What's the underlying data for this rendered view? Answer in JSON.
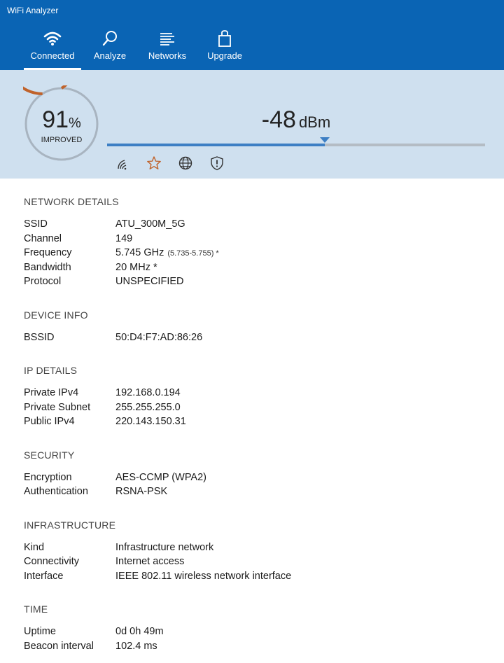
{
  "app": {
    "title": "WiFi Analyzer"
  },
  "nav": {
    "items": [
      {
        "label": "Connected",
        "icon": "wifi-icon"
      },
      {
        "label": "Analyze",
        "icon": "magnifier-icon"
      },
      {
        "label": "Networks",
        "icon": "list-icon"
      },
      {
        "label": "Upgrade",
        "icon": "shopping-bag-icon"
      }
    ],
    "active": "Connected"
  },
  "signal": {
    "quality_value": "91",
    "quality_unit": "%",
    "quality_label": "IMPROVED",
    "quality_fraction": 0.91,
    "dbm_value": "-48",
    "dbm_unit": "dBm",
    "meter_fraction": 0.575,
    "colors": {
      "gauge_ring": "#c0622a",
      "gauge_track": "#a8b4c0",
      "meter": "#3d7fc4",
      "star": "#c0622a"
    },
    "status_icons": [
      "signal-bars-icon",
      "star-icon",
      "globe-icon",
      "shield-icon"
    ]
  },
  "sections": {
    "network": {
      "title": "NETWORK DETAILS",
      "ssid_k": "SSID",
      "ssid_v": "ATU_300M_5G",
      "channel_k": "Channel",
      "channel_v": "149",
      "frequency_k": "Frequency",
      "frequency_v": "5.745 GHz",
      "frequency_range": "(5.735-5.755) *",
      "bandwidth_k": "Bandwidth",
      "bandwidth_v": "20 MHz *",
      "protocol_k": "Protocol",
      "protocol_v": "UNSPECIFIED"
    },
    "device": {
      "title": "DEVICE INFO",
      "bssid_k": "BSSID",
      "bssid_v": "50:D4:F7:AD:86:26"
    },
    "ip": {
      "title": "IP DETAILS",
      "private_ipv4_k": "Private IPv4",
      "private_ipv4_v": "192.168.0.194",
      "private_subnet_k": "Private Subnet",
      "private_subnet_v": "255.255.255.0",
      "public_ipv4_k": "Public IPv4",
      "public_ipv4_v": "220.143.150.31"
    },
    "security": {
      "title": "SECURITY",
      "encryption_k": "Encryption",
      "encryption_v": "AES-CCMP (WPA2)",
      "authentication_k": "Authentication",
      "authentication_v": "RSNA-PSK"
    },
    "infrastructure": {
      "title": "INFRASTRUCTURE",
      "kind_k": "Kind",
      "kind_v": "Infrastructure network",
      "connectivity_k": "Connectivity",
      "connectivity_v": "Internet access",
      "interface_k": "Interface",
      "interface_v": "IEEE 802.11 wireless network interface"
    },
    "time": {
      "title": "TIME",
      "uptime_k": "Uptime",
      "uptime_v": "0d 0h 49m",
      "beacon_k": "Beacon interval",
      "beacon_v": "102.4 ms"
    }
  }
}
